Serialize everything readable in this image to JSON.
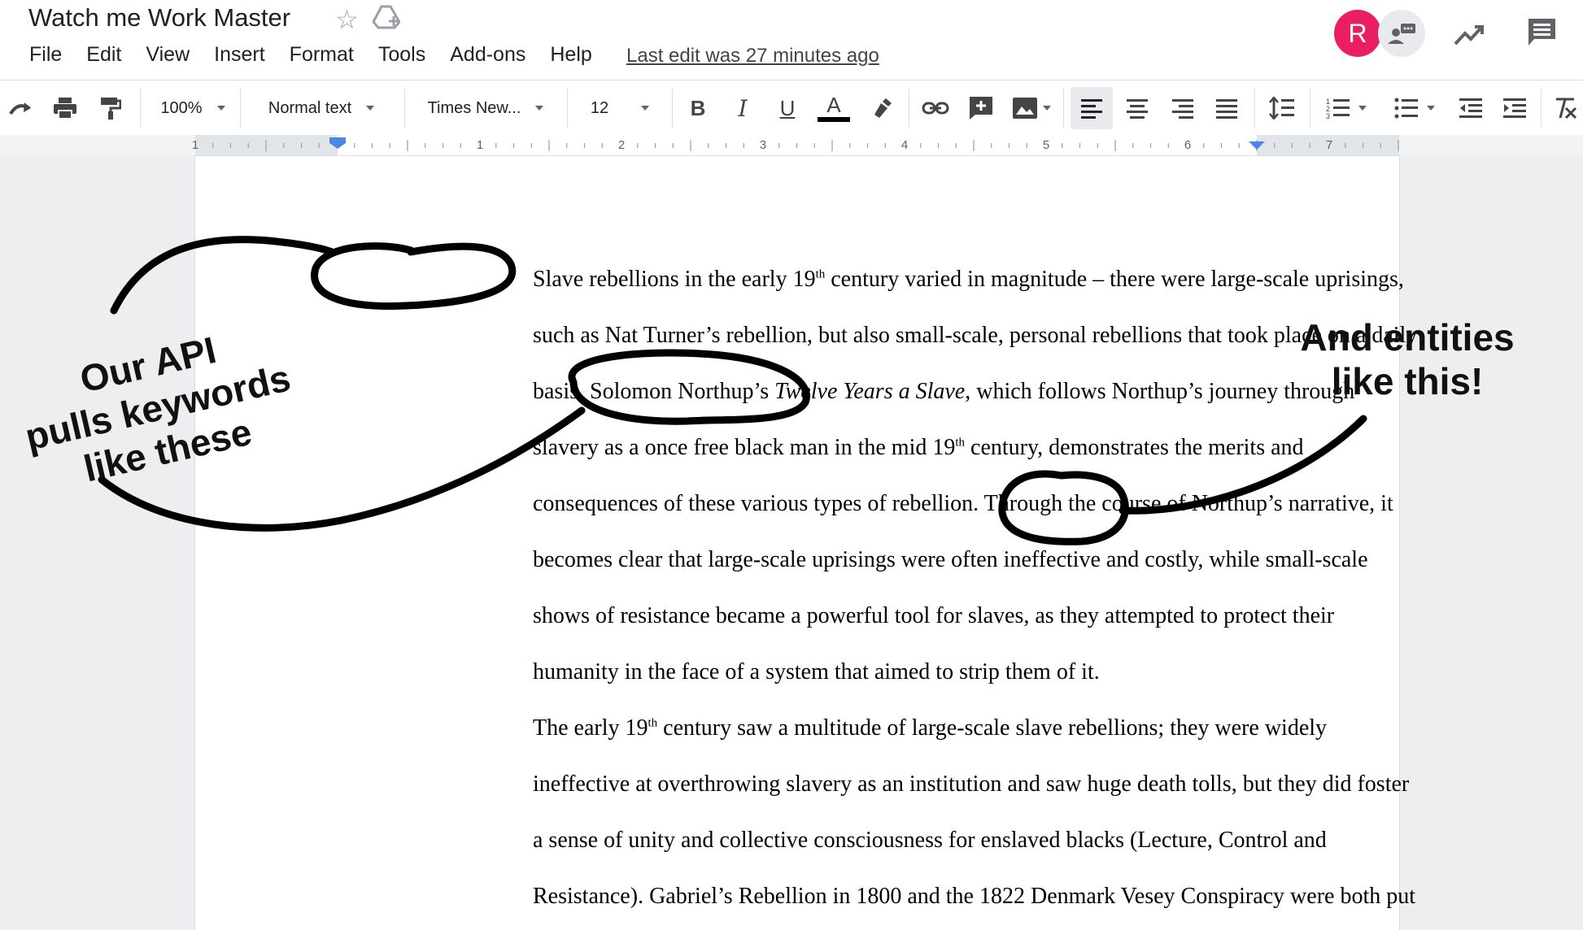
{
  "header": {
    "title": "Watch me Work Master",
    "menus": [
      "File",
      "Edit",
      "View",
      "Insert",
      "Format",
      "Tools",
      "Add-ons",
      "Help"
    ],
    "last_edit": "Last edit was 27 minutes ago",
    "avatar_initial": "R",
    "icons": [
      "star-icon",
      "drive-icon",
      "collaborator-icon",
      "activity-icon",
      "comments-icon"
    ]
  },
  "toolbar": {
    "zoom": "100%",
    "style": "Normal text",
    "font": "Times New...",
    "font_size": "12",
    "icons": [
      "redo-icon",
      "print-icon",
      "paint-format-icon",
      "bold-icon",
      "italic-icon",
      "underline-icon",
      "text-color-icon",
      "highlight-icon",
      "link-icon",
      "add-comment-icon",
      "image-icon",
      "align-left-icon",
      "align-center-icon",
      "align-right-icon",
      "justify-icon",
      "line-spacing-icon",
      "numbered-list-icon",
      "bulleted-list-icon",
      "decrease-indent-icon",
      "increase-indent-icon",
      "clear-formatting-icon"
    ],
    "bold_label": "B",
    "italic_label": "I",
    "underline_label": "U",
    "text_color_label": "A"
  },
  "ruler": {
    "numbers": [
      "1",
      "1",
      "2",
      "3",
      "4",
      "5",
      "6",
      "7"
    ]
  },
  "document": {
    "p1": {
      "l1a": "Slave rebellions in the early 19",
      "l1sup": "th",
      "l1b": " century varied in magnitude – there were large-scale uprisings,",
      "l2": "such as Nat Turner’s rebellion, but also small-scale, personal rebellions that took place on a daily",
      "l3a": "basis. Solomon Northup’s ",
      "l3i": "Twelve Years a Slave",
      "l3b": ", which follows Northup’s journey through",
      "l4a": "slavery as a once free black man in the mid 19",
      "l4sup": "th",
      "l4b": " century, demonstrates the merits and",
      "l5": "consequences of these various types of rebellion. Through the course of Northup’s narrative, it",
      "l6": "becomes clear that large-scale uprisings were often ineffective and costly, while small-scale",
      "l7": "shows of resistance became a powerful tool for slaves, as they attempted to protect their",
      "l8": "humanity in the face of a system that aimed to strip them of it."
    },
    "p2": {
      "l1a": "The early 19",
      "l1sup": "th",
      "l1b": " century saw a multitude of large-scale slave rebellions; they were widely",
      "l2": "ineffective at overthrowing slavery as an institution and saw huge death tolls, but they did foster",
      "l3": "a sense of unity and collective consciousness for enslaved blacks (Lecture, Control and",
      "l4": "Resistance). Gabriel’s Rebellion in 1800 and the 1822 Denmark Vesey Conspiracy were both put"
    }
  },
  "annotations": {
    "left_l1": "Our API",
    "left_l2": "pulls keywords",
    "left_l3": "like these",
    "right_l1": "And entities",
    "right_l2": "like this!"
  },
  "colors": {
    "avatar": "#e91e63",
    "ink": "#000000",
    "toolbar_active": "#e8eaed"
  }
}
